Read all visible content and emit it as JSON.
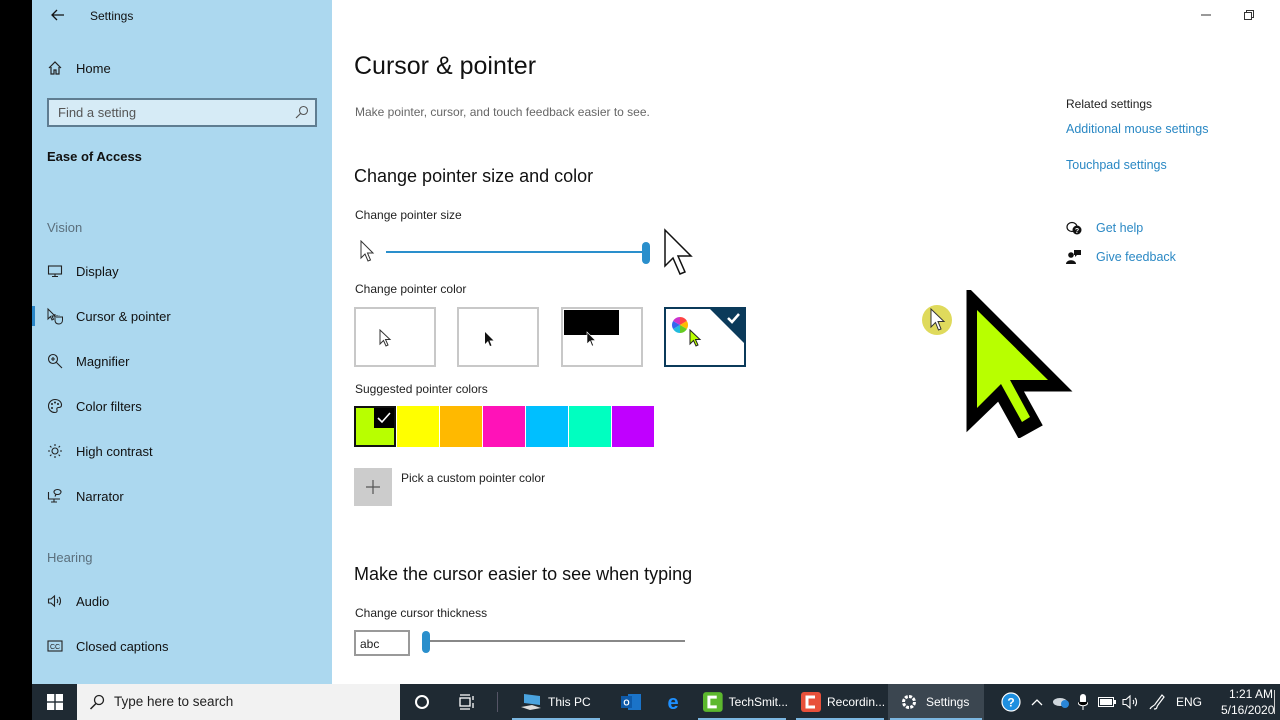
{
  "window": {
    "app_title": "Settings",
    "minimize_icon": "minimize-icon",
    "restore_icon": "restore-icon"
  },
  "sidebar": {
    "home_label": "Home",
    "search_placeholder": "Find a setting",
    "group_title": "Ease of Access",
    "sections": [
      {
        "header": "Vision",
        "items": [
          {
            "label": "Display",
            "icon": "monitor-icon"
          },
          {
            "label": "Cursor & pointer",
            "icon": "pointer-hand-icon",
            "active": true
          },
          {
            "label": "Magnifier",
            "icon": "magnifier-icon"
          },
          {
            "label": "Color filters",
            "icon": "palette-icon"
          },
          {
            "label": "High contrast",
            "icon": "sun-icon"
          },
          {
            "label": "Narrator",
            "icon": "narrator-icon"
          }
        ]
      },
      {
        "header": "Hearing",
        "items": [
          {
            "label": "Audio",
            "icon": "speaker-icon"
          },
          {
            "label": "Closed captions",
            "icon": "cc-icon"
          }
        ]
      }
    ]
  },
  "main": {
    "title": "Cursor & pointer",
    "description": "Make pointer, cursor, and touch feedback easier to see.",
    "pointer_section": {
      "heading": "Change pointer size and color",
      "size_label": "Change pointer size",
      "size_value_fraction": 1.0,
      "color_label": "Change pointer color",
      "color_options": [
        {
          "name": "white",
          "selected": false
        },
        {
          "name": "black",
          "selected": false
        },
        {
          "name": "inverted",
          "selected": false
        },
        {
          "name": "custom",
          "selected": true
        }
      ],
      "suggested_label": "Suggested pointer colors",
      "suggested_colors": [
        {
          "hex": "#b8ff00",
          "selected": true
        },
        {
          "hex": "#ffff00",
          "selected": false
        },
        {
          "hex": "#ffb900",
          "selected": false
        },
        {
          "hex": "#ff12b8",
          "selected": false
        },
        {
          "hex": "#00bfff",
          "selected": false
        },
        {
          "hex": "#00ffc0",
          "selected": false
        },
        {
          "hex": "#c000ff",
          "selected": false
        }
      ],
      "custom_label": "Pick a custom pointer color"
    },
    "typing_section": {
      "heading": "Make the cursor easier to see when typing",
      "thickness_label": "Change cursor thickness",
      "preview_text": "abc",
      "thickness_value_fraction": 0.0
    }
  },
  "related": {
    "header": "Related settings",
    "links": [
      "Additional mouse settings",
      "Touchpad settings"
    ],
    "help_label": "Get help",
    "feedback_label": "Give feedback"
  },
  "taskbar": {
    "search_placeholder": "Type here to search",
    "apps": [
      {
        "label": "This PC",
        "icon": "this-pc-icon"
      },
      {
        "label": "",
        "icon": "outlook-icon"
      },
      {
        "label": "",
        "icon": "edge-icon"
      },
      {
        "label": "TechSmit...",
        "icon": "camtasia-icon"
      },
      {
        "label": "Recordin...",
        "icon": "recorder-icon"
      },
      {
        "label": "Settings",
        "icon": "gear-icon",
        "active": true
      }
    ],
    "tray": {
      "language": "ENG",
      "time": "1:21 AM",
      "date": "5/16/2020"
    }
  },
  "accent_color": "#2a8fcc"
}
